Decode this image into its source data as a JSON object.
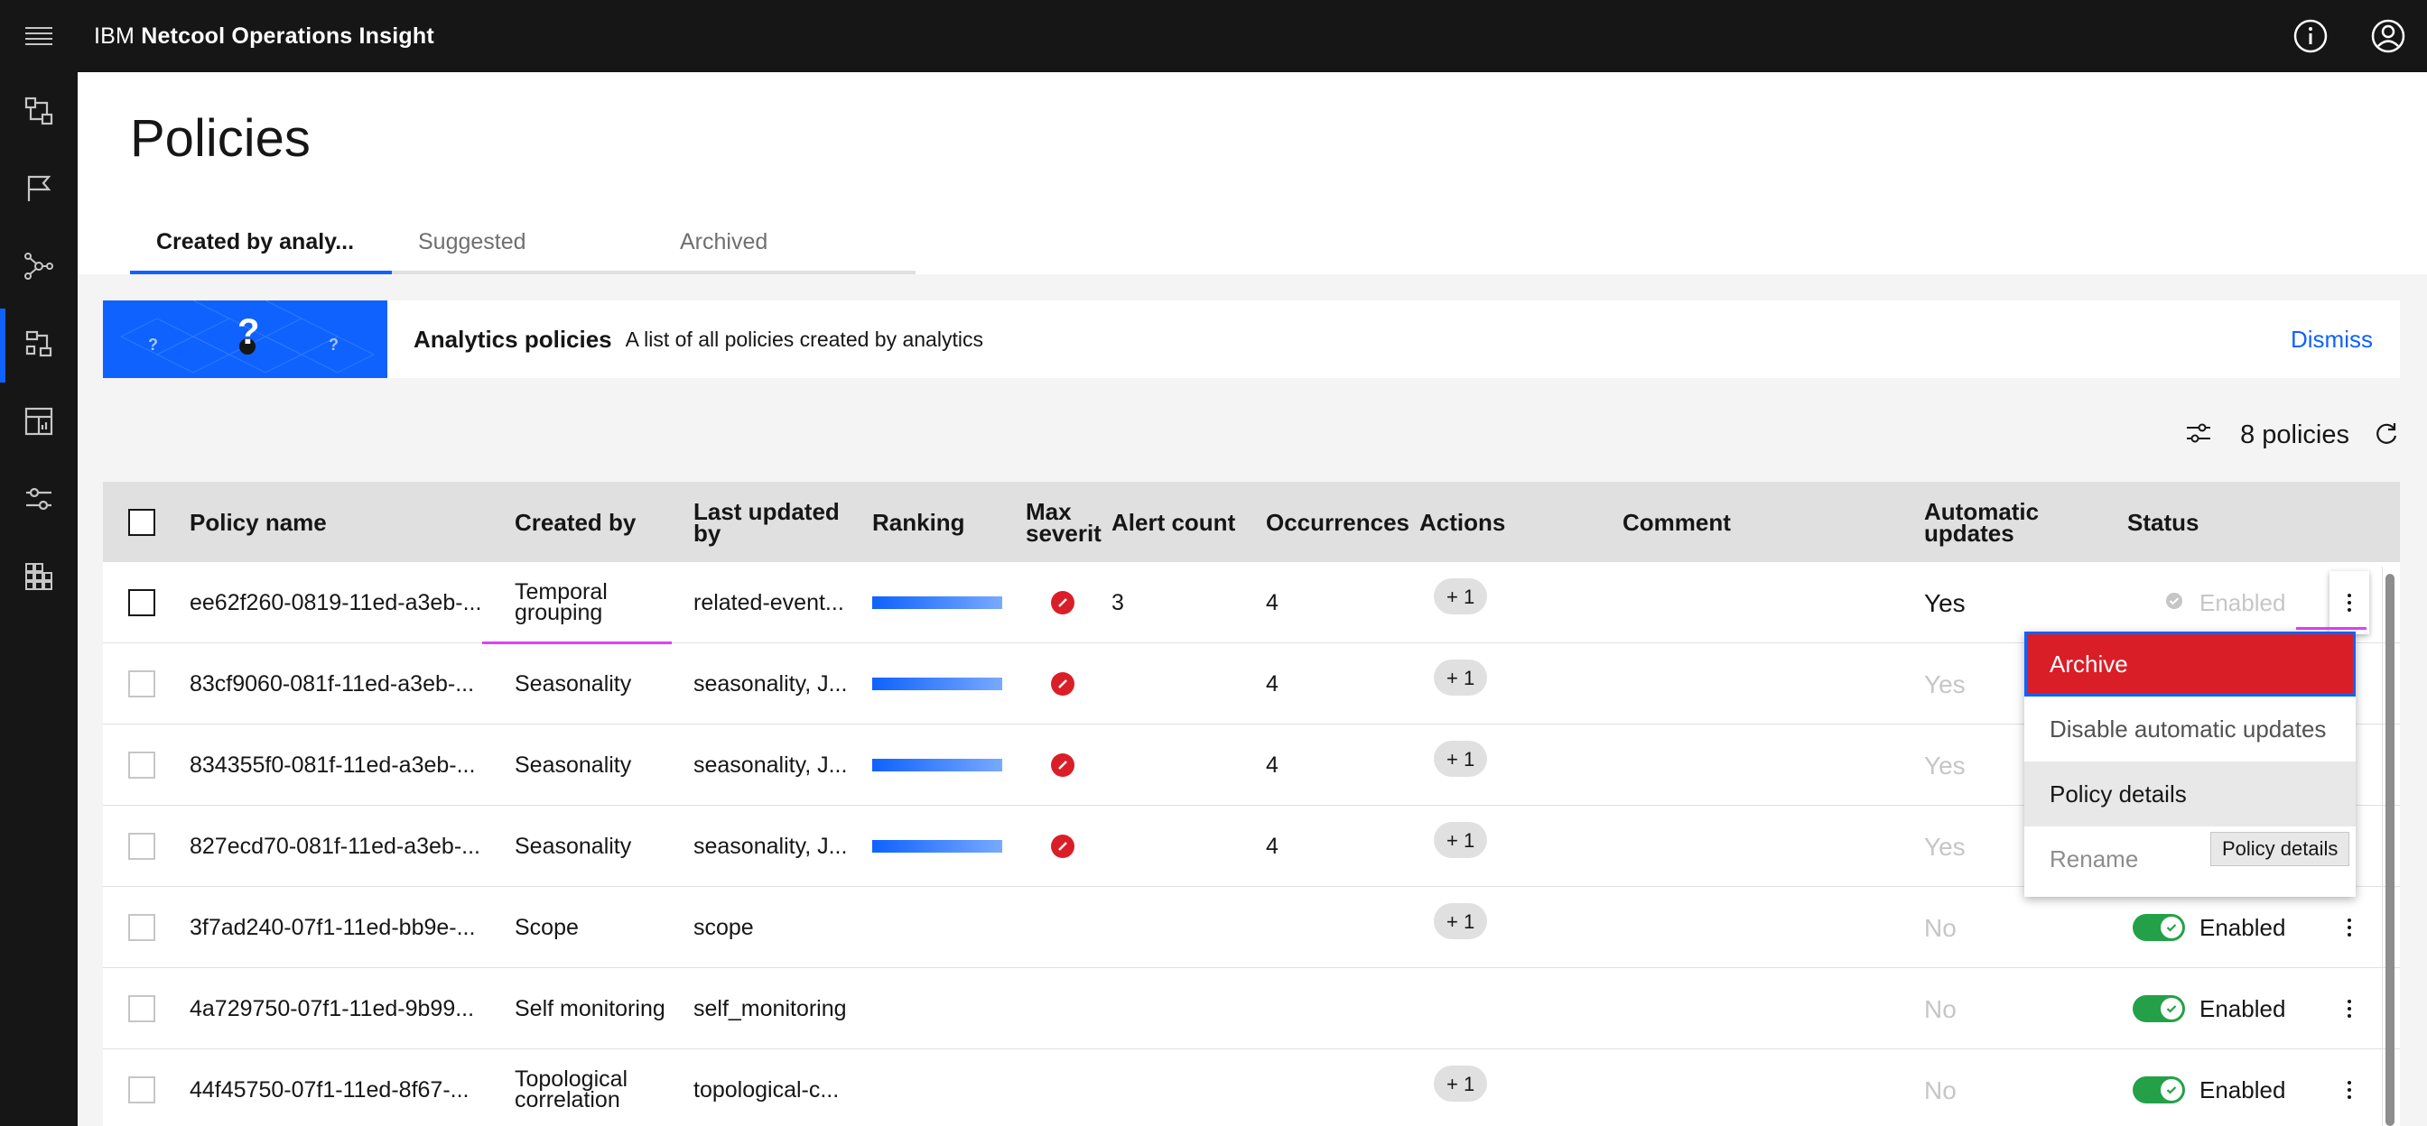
{
  "header": {
    "brand_prefix": "IBM",
    "brand_product": "Netcool Operations Insight"
  },
  "page": {
    "title": "Policies",
    "tabs": [
      {
        "label": "Created by analy..."
      },
      {
        "label": "Suggested"
      },
      {
        "label": "Archived"
      }
    ]
  },
  "banner": {
    "title": "Analytics policies",
    "description": "A list of all policies created by analytics",
    "dismiss": "Dismiss"
  },
  "toolbar": {
    "count_label": "8 policies"
  },
  "table": {
    "columns": {
      "policy_name": "Policy name",
      "created_by": "Created by",
      "last_updated_1": "Last updated",
      "last_updated_2": "by",
      "ranking": "Ranking",
      "max_sev_1": "Max",
      "max_sev_2": "severit",
      "alert_count": "Alert count",
      "occurrences": "Occurrences",
      "actions": "Actions",
      "comment": "Comment",
      "auto_1": "Automatic",
      "auto_2": "updates",
      "status": "Status"
    },
    "rows": [
      {
        "name": "ee62f260-0819-11ed-a3eb-...",
        "created_by_1": "Temporal",
        "created_by_2": "grouping",
        "last_updated": "related-event...",
        "ranking": 1,
        "severity_icon": "critical-icon",
        "alert_count": "3",
        "occurrences": "4",
        "actions_tag": "+ 1",
        "auto_updates": "Yes",
        "status": "Enabled"
      },
      {
        "name": "83cf9060-081f-11ed-a3eb-...",
        "created_by_1": "Seasonality",
        "created_by_2": "",
        "last_updated": "seasonality, J...",
        "ranking": 1,
        "severity_icon": "critical-icon",
        "alert_count": "",
        "occurrences": "4",
        "actions_tag": "+ 1",
        "auto_updates": "Yes",
        "status": ""
      },
      {
        "name": "834355f0-081f-11ed-a3eb-...",
        "created_by_1": "Seasonality",
        "created_by_2": "",
        "last_updated": "seasonality, J...",
        "ranking": 1,
        "severity_icon": "critical-icon",
        "alert_count": "",
        "occurrences": "4",
        "actions_tag": "+ 1",
        "auto_updates": "Yes",
        "status": ""
      },
      {
        "name": "827ecd70-081f-11ed-a3eb-...",
        "created_by_1": "Seasonality",
        "created_by_2": "",
        "last_updated": "seasonality, J...",
        "ranking": 1,
        "severity_icon": "critical-icon",
        "alert_count": "",
        "occurrences": "4",
        "actions_tag": "+ 1",
        "auto_updates": "Yes",
        "status": ""
      },
      {
        "name": "3f7ad240-07f1-11ed-bb9e-...",
        "created_by_1": "Scope",
        "created_by_2": "",
        "last_updated": "scope",
        "actions_tag": "+ 1",
        "auto_updates": "No",
        "status": "Enabled"
      },
      {
        "name": "4a729750-07f1-11ed-9b99...",
        "created_by_1": "Self monitoring",
        "created_by_2": "",
        "last_updated": "self_monitoring",
        "actions_tag": "",
        "auto_updates": "No",
        "status": "Enabled"
      },
      {
        "name": "44f45750-07f1-11ed-8f67-...",
        "created_by_1": "Topological",
        "created_by_2": "correlation",
        "last_updated": "topological-c...",
        "actions_tag": "+ 1",
        "auto_updates": "No",
        "status": "Enabled"
      }
    ]
  },
  "overflow_menu": {
    "items": [
      "Archive",
      "Disable automatic updates",
      "Policy details",
      "Rename"
    ],
    "tooltip": "Policy details"
  },
  "colors": {
    "accent": "#0f62fe",
    "danger": "#da1e28",
    "success": "#24a148",
    "annotation": "#e040fb"
  }
}
